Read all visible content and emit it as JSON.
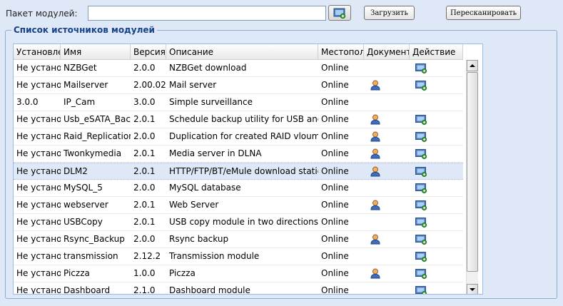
{
  "upload": {
    "label": "Пакет модулей:",
    "file_value": "",
    "upload_label": "Загрузить",
    "rescan_label": "Пересканировать"
  },
  "module_list": {
    "legend": "Список источников модулей",
    "columns": {
      "status": "Установле",
      "name": "Имя",
      "version": "Версия",
      "description": "Описание",
      "location": "Местопол",
      "document": "Документ",
      "action": "Действие"
    },
    "rows": [
      {
        "status": "Не установ",
        "name": "NZBGet",
        "version": "2.0.0",
        "description": "NZBGet download",
        "location": "Online",
        "doc": false,
        "action": true
      },
      {
        "status": "Не установ",
        "name": "Mailserver",
        "version": "2.00.02",
        "description": "Mail server",
        "location": "Online",
        "doc": true,
        "action": true
      },
      {
        "status": "3.0.0",
        "name": "IP_Cam",
        "version": "3.0.0",
        "description": "Simple surveillance",
        "location": "Online",
        "doc": false,
        "action": false
      },
      {
        "status": "Не установ",
        "name": "Usb_eSATA_Backup",
        "version": "2.0.1",
        "description": "Schedule backup utility for USB and eSATA",
        "location": "Online",
        "doc": true,
        "action": true
      },
      {
        "status": "Не установ",
        "name": "Raid_Replication",
        "version": "2.0.0",
        "description": "Duplication for created RAID vloume",
        "location": "Online",
        "doc": true,
        "action": true
      },
      {
        "status": "Не установ",
        "name": "Twonkymedia",
        "version": "2.0.1",
        "description": "Media server in DLNA",
        "location": "Online",
        "doc": true,
        "action": true
      },
      {
        "status": "Не установ",
        "name": "DLM2",
        "version": "2.0.1",
        "description": "HTTP/FTP/BT/eMule download station",
        "location": "Online",
        "doc": true,
        "action": true,
        "selected": true
      },
      {
        "status": "Не установ",
        "name": "MySQL_5",
        "version": "2.0.0",
        "description": "MySQL database",
        "location": "Online",
        "doc": false,
        "action": true
      },
      {
        "status": "Не установ",
        "name": "webserver",
        "version": "2.0.1",
        "description": "Web Server",
        "location": "Online",
        "doc": true,
        "action": true
      },
      {
        "status": "Не установ",
        "name": "USBCopy",
        "version": "2.0.1",
        "description": "USB copy module in two directions",
        "location": "Online",
        "doc": false,
        "action": true
      },
      {
        "status": "Не установ",
        "name": "Rsync_Backup",
        "version": "2.0.0",
        "description": "Rsync backup",
        "location": "Online",
        "doc": true,
        "action": true
      },
      {
        "status": "Не установ",
        "name": "transmission",
        "version": "2.12.2",
        "description": "Transmission module",
        "location": "Online",
        "doc": false,
        "action": true
      },
      {
        "status": "Не установ",
        "name": "Piczza",
        "version": "1.0.0",
        "description": "Piczza",
        "location": "Online",
        "doc": true,
        "action": true
      },
      {
        "status": "Не установ",
        "name": "Dashboard",
        "version": "2.1.0",
        "description": "Dashboard module",
        "location": "Online",
        "doc": false,
        "action": true
      }
    ]
  },
  "icons": {
    "browse": "upload-file-icon",
    "document": "user-document-icon",
    "action": "install-module-icon",
    "scroll_up": "arrow-up-icon",
    "scroll_down": "arrow-down-icon"
  }
}
